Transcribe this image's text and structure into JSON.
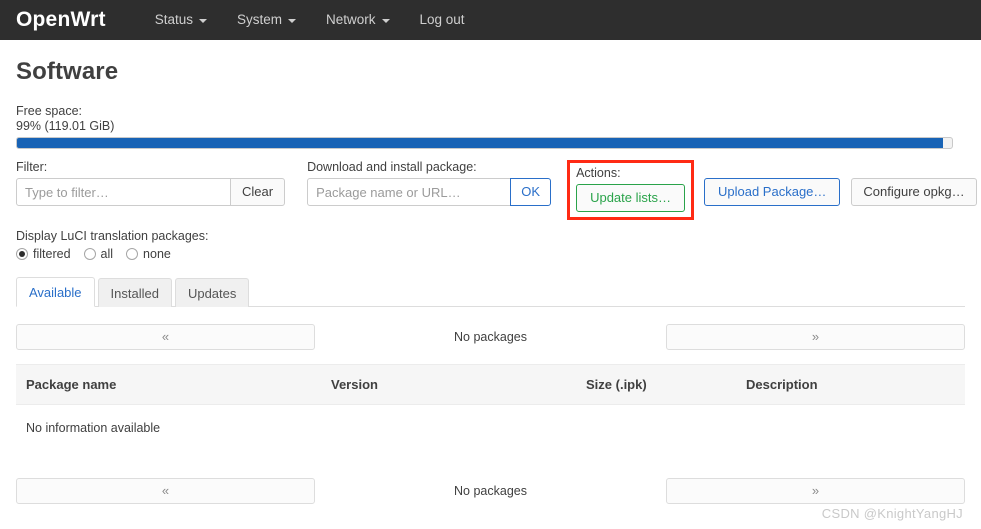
{
  "navbar": {
    "brand": "OpenWrt",
    "items": [
      {
        "label": "Status",
        "has_caret": true
      },
      {
        "label": "System",
        "has_caret": true
      },
      {
        "label": "Network",
        "has_caret": true
      },
      {
        "label": "Log out",
        "has_caret": false
      }
    ]
  },
  "page": {
    "title": "Software"
  },
  "free_space": {
    "label": "Free space:",
    "value_text": "99% (119.01 GiB)",
    "percent": 99,
    "bar_color": "#1863b5"
  },
  "filter": {
    "label": "Filter:",
    "placeholder": "Type to filter…",
    "value": "",
    "clear_label": "Clear"
  },
  "download": {
    "label": "Download and install package:",
    "placeholder": "Package name or URL…",
    "value": "",
    "ok_label": "OK",
    "ok_color": "#2a6fc9"
  },
  "actions": {
    "label": "Actions:",
    "update_lists_label": "Update lists…",
    "update_lists_color": "#2aa34a",
    "upload_package_label": "Upload Package…",
    "upload_package_color": "#2a6fc9",
    "configure_opkg_label": "Configure opkg…",
    "highlight_color": "#ff2a14"
  },
  "translation": {
    "label": "Display LuCI translation packages:",
    "options": [
      {
        "label": "filtered",
        "checked": true
      },
      {
        "label": "all",
        "checked": false
      },
      {
        "label": "none",
        "checked": false
      }
    ]
  },
  "tabs": [
    {
      "label": "Available",
      "active": true
    },
    {
      "label": "Installed",
      "active": false
    },
    {
      "label": "Updates",
      "active": false
    }
  ],
  "pager": {
    "prev_label": "«",
    "next_label": "»",
    "info": "No packages"
  },
  "table": {
    "headers": [
      "Package name",
      "Version",
      "Size (.ipk)",
      "Description"
    ],
    "empty_message": "No information available"
  },
  "watermark": "CSDN @KnightYangHJ"
}
